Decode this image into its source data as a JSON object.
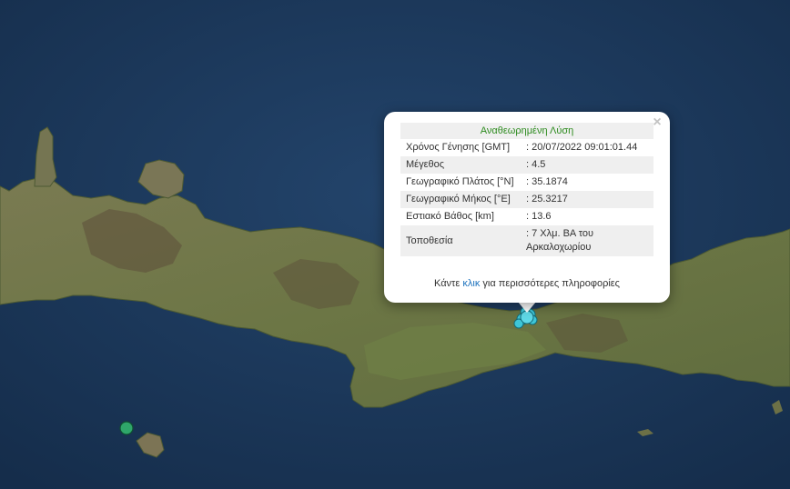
{
  "popup": {
    "title": "Αναθεωρημένη Λύση",
    "close_icon": "×",
    "rows": [
      {
        "key": "Χρόνος Γένησης [GMT]",
        "value": ": 20/07/2022 09:01:01.44"
      },
      {
        "key": "Μέγεθος",
        "value": ": 4.5"
      },
      {
        "key": "Γεωγραφικό Πλάτος [°N]",
        "value": ": 35.1874"
      },
      {
        "key": "Γεωγραφικό Μήκος [°E]",
        "value": ": 25.3217"
      },
      {
        "key": "Εστιακό Βάθος [km]",
        "value": ": 13.6"
      },
      {
        "key": "Τοποθεσία",
        "value": ": 7 Χλμ. ΒΑ του Αρκαλοχωρίου"
      }
    ],
    "more_prefix": "Κάντε ",
    "more_link": "κλικ",
    "more_suffix": " για περισσότερες πληροφορίες"
  },
  "colors": {
    "sea": "#1d3a5e",
    "land": "#6f7a4a",
    "epicenter_marker": "#3ec6d8",
    "other_marker": "#2fa66a",
    "title_green": "#2e8b1f",
    "link": "#1e73be"
  }
}
